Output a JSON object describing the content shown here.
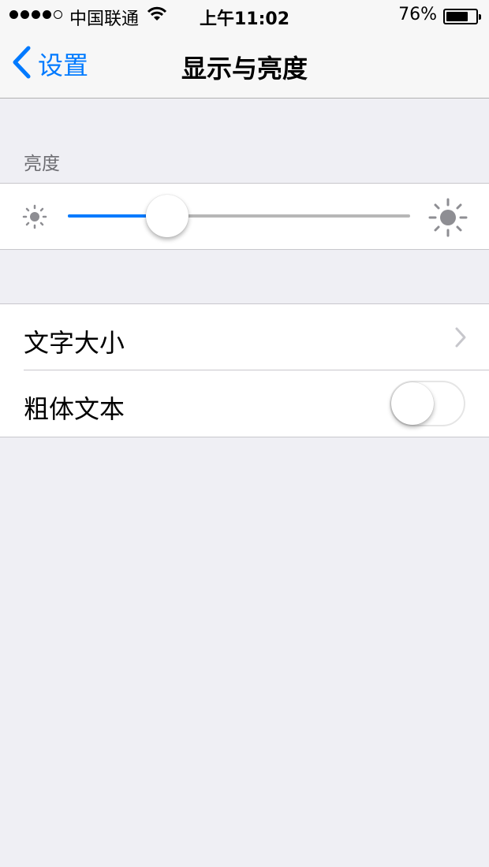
{
  "status_bar": {
    "carrier": "中国联通",
    "time": "上午11:02",
    "battery_percent": "76%",
    "battery_level": 0.76,
    "signal_bars_filled": 4,
    "signal_bars_total": 5
  },
  "nav": {
    "back_label": "设置",
    "title": "显示与亮度"
  },
  "brightness": {
    "section_title": "亮度",
    "level": 0.29
  },
  "text_settings": {
    "items": [
      {
        "label": "文字大小",
        "accessory": "chevron"
      },
      {
        "label": "粗体文本",
        "accessory": "toggle",
        "on": false
      }
    ]
  },
  "colors": {
    "accent": "#007aff",
    "background": "#efeff4",
    "separator": "#c8c7cc"
  },
  "icons": {
    "wifi": "wifi-icon",
    "back": "chevron-left-icon",
    "brightness_low": "sun-small-icon",
    "brightness_high": "sun-large-icon",
    "disclosure": "chevron-right-icon"
  }
}
